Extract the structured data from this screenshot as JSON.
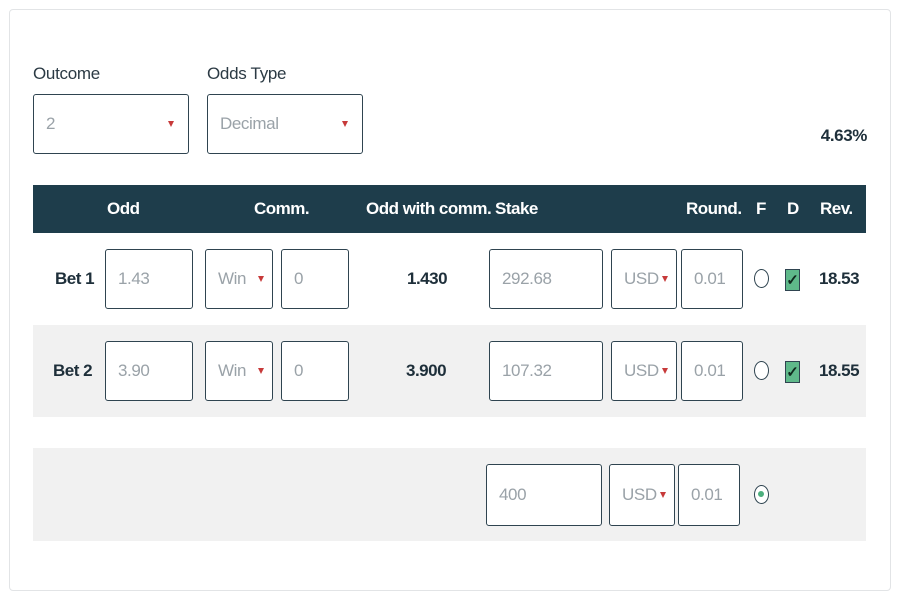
{
  "form": {
    "outcome_label": "Outcome",
    "outcome_value": "2",
    "odds_type_label": "Odds Type",
    "odds_type_value": "Decimal",
    "margin": "4.63%"
  },
  "table": {
    "headers": {
      "odd": "Odd",
      "comm": "Comm.",
      "odd_with_comm": "Odd with comm.",
      "stake": "Stake",
      "round": "Round.",
      "f": "F",
      "d": "D",
      "rev": "Rev."
    },
    "rows": [
      {
        "label": "Bet 1",
        "odd": "1.43",
        "comm_type": "Win",
        "comm_value": "0",
        "odd_with_comm": "1.430",
        "stake": "292.68",
        "currency": "USD",
        "round": "0.01",
        "fixed": false,
        "d_checked": true,
        "rev": "18.53"
      },
      {
        "label": "Bet 2",
        "odd": "3.90",
        "comm_type": "Win",
        "comm_value": "0",
        "odd_with_comm": "3.900",
        "stake": "107.32",
        "currency": "USD",
        "round": "0.01",
        "fixed": false,
        "d_checked": true,
        "rev": "18.55"
      }
    ],
    "total": {
      "stake": "400",
      "currency": "USD",
      "round": "0.01",
      "fixed": true
    }
  },
  "colors": {
    "header_bg": "#1e3d4b",
    "accent_caret": "#c73a3a",
    "check_fill": "#5fb98a"
  }
}
